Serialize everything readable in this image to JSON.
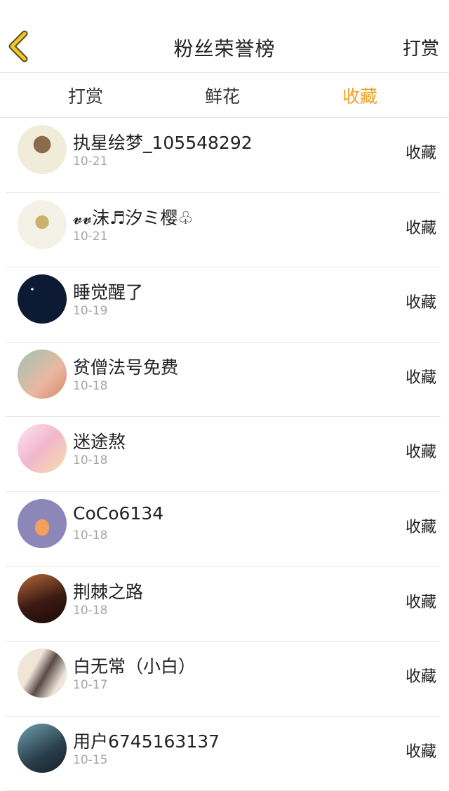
{
  "header": {
    "title": "粉丝荣誉榜",
    "back_icon": "chevron-left-icon",
    "right_action": "打赏",
    "accent_color": "#f1a12b"
  },
  "tabs": [
    {
      "label": "打赏",
      "active": false
    },
    {
      "label": "鲜花",
      "active": false
    },
    {
      "label": "收藏",
      "active": true
    }
  ],
  "fans": [
    {
      "name": "执星绘梦_105548292",
      "date": "10-21",
      "action": "收藏",
      "avatar_colors": [
        "#f1ecd9",
        "#8a6b4c"
      ]
    },
    {
      "name": "𝓿𝓿沫♬汐ミ樱♧",
      "date": "10-21",
      "action": "收藏",
      "avatar_colors": [
        "#f4f2e6",
        "#c9b26a"
      ]
    },
    {
      "name": "睡觉醒了",
      "date": "10-19",
      "action": "收藏",
      "avatar_colors": [
        "#0d1a33",
        "#0a1326"
      ]
    },
    {
      "name": "贫僧法号免费",
      "date": "10-18",
      "action": "收藏",
      "avatar_colors": [
        "#9fc4b5",
        "#e9b8a0"
      ]
    },
    {
      "name": "迷途熬",
      "date": "10-18",
      "action": "收藏",
      "avatar_colors": [
        "#f6d8e9",
        "#f2b6cc"
      ]
    },
    {
      "name": "CoCo6134",
      "date": "10-18",
      "action": "收藏",
      "avatar_colors": [
        "#8d86b8",
        "#f2a05c"
      ]
    },
    {
      "name": "荆棘之路",
      "date": "10-18",
      "action": "收藏",
      "avatar_colors": [
        "#3b1a12",
        "#b5683a"
      ]
    },
    {
      "name": "白无常（小白）",
      "date": "10-17",
      "action": "收藏",
      "avatar_colors": [
        "#efe6d8",
        "#5a4a4a"
      ]
    },
    {
      "name": "用户6745163137",
      "date": "10-15",
      "action": "收藏",
      "avatar_colors": [
        "#2a3d4a",
        "#6fa0b0"
      ]
    }
  ]
}
